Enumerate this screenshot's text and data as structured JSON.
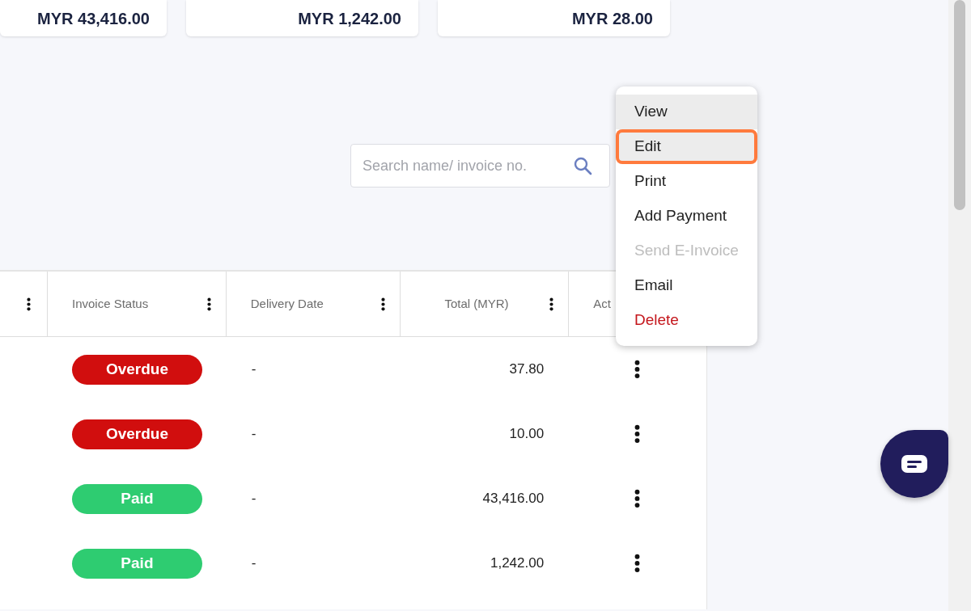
{
  "summary_cards": [
    {
      "amount": "MYR 43,416.00"
    },
    {
      "amount": "MYR 1,242.00"
    },
    {
      "amount": "MYR 28.00"
    }
  ],
  "search": {
    "placeholder": "Search name/ invoice no."
  },
  "table": {
    "columns": [
      {
        "label": "Invoice Status"
      },
      {
        "label": "Delivery Date"
      },
      {
        "label": "Total (MYR)"
      },
      {
        "label": "Act"
      }
    ],
    "rows": [
      {
        "status": "Overdue",
        "color": "#d10e0e",
        "delivery_date": "-",
        "total": "37.80"
      },
      {
        "status": "Overdue",
        "color": "#d10e0e",
        "delivery_date": "-",
        "total": "10.00"
      },
      {
        "status": "Paid",
        "color": "#2ecc71",
        "delivery_date": "-",
        "total": "43,416.00"
      },
      {
        "status": "Paid",
        "color": "#2ecc71",
        "delivery_date": "-",
        "total": "1,242.00"
      }
    ]
  },
  "action_menu": {
    "items": [
      {
        "label": "View",
        "kind": "normal",
        "highlighted": true,
        "selected": false,
        "disabled": false
      },
      {
        "label": "Edit",
        "kind": "normal",
        "highlighted": true,
        "selected": true,
        "disabled": false
      },
      {
        "label": "Print",
        "kind": "normal",
        "highlighted": false,
        "selected": false,
        "disabled": false
      },
      {
        "label": "Add Payment",
        "kind": "normal",
        "highlighted": false,
        "selected": false,
        "disabled": false
      },
      {
        "label": "Send E-Invoice",
        "kind": "normal",
        "highlighted": false,
        "selected": false,
        "disabled": true
      },
      {
        "label": "Email",
        "kind": "normal",
        "highlighted": false,
        "selected": false,
        "disabled": false
      },
      {
        "label": "Delete",
        "kind": "danger",
        "highlighted": false,
        "selected": false,
        "disabled": false
      }
    ]
  }
}
